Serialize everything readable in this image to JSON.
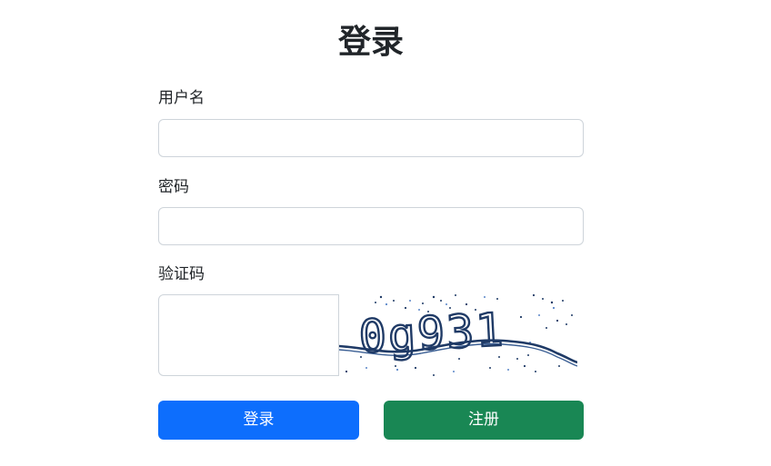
{
  "page": {
    "title": "登录"
  },
  "form": {
    "username_label": "用户名",
    "username_value": "",
    "password_label": "密码",
    "password_value": "",
    "captcha_label": "验证码",
    "captcha_value": "",
    "captcha_text": "0g931"
  },
  "buttons": {
    "login_label": "登录",
    "register_label": "注册"
  },
  "colors": {
    "primary": "#0d6efd",
    "success": "#198754",
    "captcha_ink": "#1f3a66"
  }
}
